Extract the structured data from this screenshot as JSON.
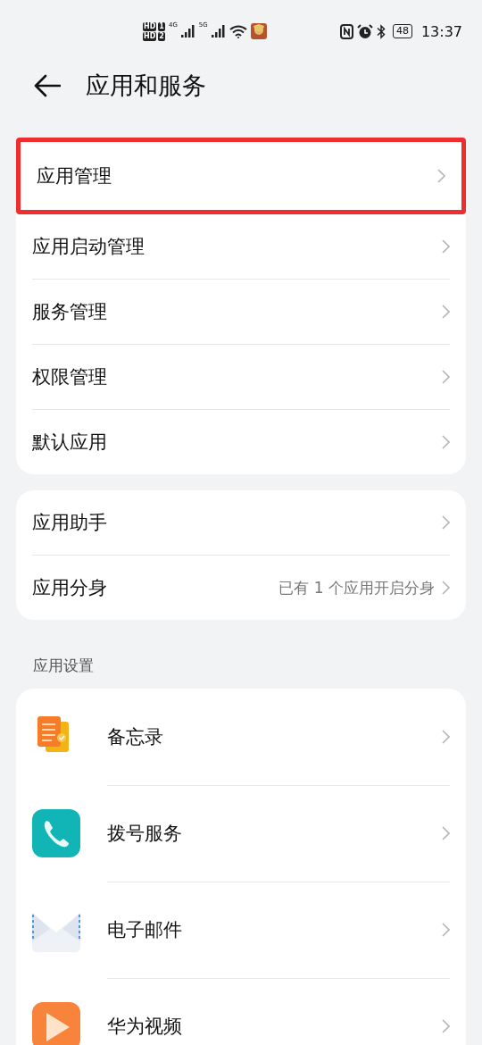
{
  "status_bar": {
    "sims": [
      {
        "badge": "HD",
        "slot": "1"
      },
      {
        "badge": "HD",
        "slot": "2"
      }
    ],
    "networks": [
      "4G",
      "5G"
    ],
    "battery": "48",
    "time": "13:37"
  },
  "header": {
    "title": "应用和服务"
  },
  "groups": [
    {
      "items": [
        {
          "label": "应用管理",
          "highlighted": true
        },
        {
          "label": "应用启动管理",
          "highlighted": false
        },
        {
          "label": "服务管理",
          "highlighted": false
        },
        {
          "label": "权限管理",
          "highlighted": false
        },
        {
          "label": "默认应用",
          "highlighted": false
        }
      ]
    },
    {
      "items": [
        {
          "label": "应用助手",
          "highlighted": false
        },
        {
          "label": "应用分身",
          "value": "已有 1 个应用开启分身",
          "highlighted": false
        }
      ]
    }
  ],
  "app_settings": {
    "title": "应用设置",
    "apps": [
      {
        "label": "备忘录"
      },
      {
        "label": "拨号服务"
      },
      {
        "label": "电子邮件"
      },
      {
        "label": "华为视频"
      }
    ]
  }
}
